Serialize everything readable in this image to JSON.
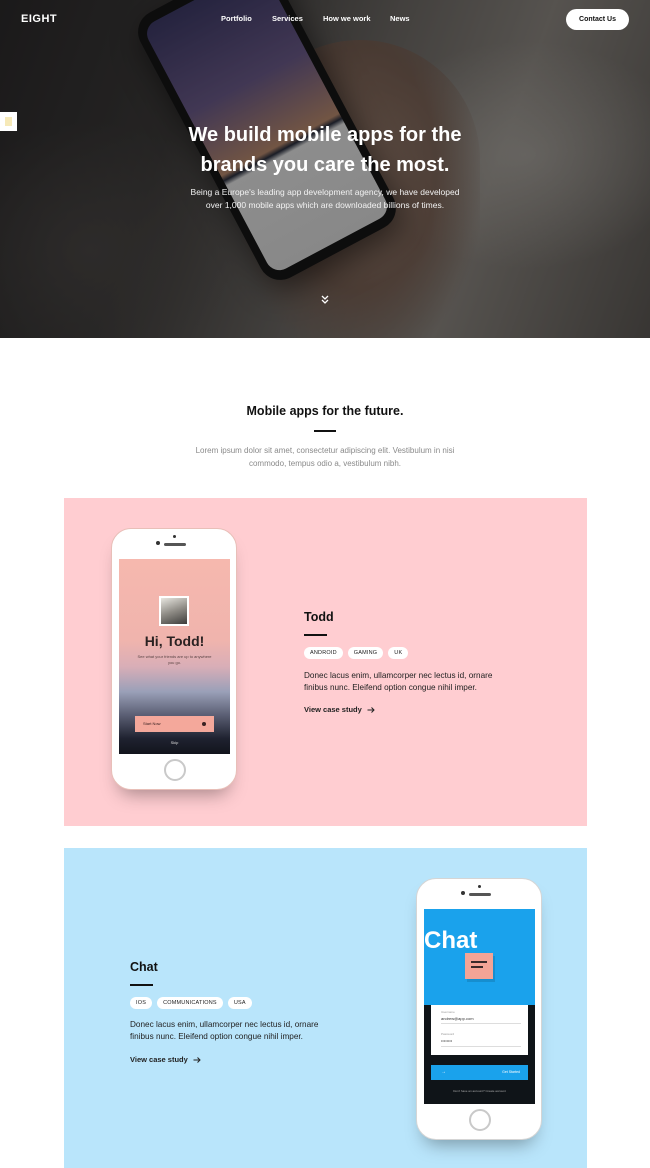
{
  "nav": {
    "logo": "EIGHT",
    "links": [
      "Portfolio",
      "Services",
      "How we work",
      "News"
    ],
    "contact_label": "Contact Us"
  },
  "hero": {
    "title_line1": "We build mobile apps for the",
    "title_line2": "brands you care the most.",
    "subtitle_line1": "Being a Europe's leading app development agency, we have developed",
    "subtitle_line2": "over 1,000 mobile apps which are downloaded billions of times.",
    "scroll_icon": "double-chevron-down-icon"
  },
  "intro": {
    "title": "Mobile apps for the future.",
    "text_line1": "Lorem ipsum dolor sit amet, consectetur adipiscing elit. Vestibulum in nisi",
    "text_line2": "commodo, tempus odio a, vestibulum nibh."
  },
  "cases": [
    {
      "title": "Todd",
      "tags": [
        "ANDROID",
        "GAMING",
        "UK"
      ],
      "desc_line1": "Donec lacus enim, ullamcorper nec lectus id, ornare",
      "desc_line2": "finibus nunc. Eleifend option congue nihil imper.",
      "link": "View case study",
      "phone": {
        "greeting": "Hi, Todd!",
        "blurb": "See what your friends are up to anywhere you go.",
        "button": "Start Now",
        "skip": "Skip"
      },
      "background": "#ffcdd1"
    },
    {
      "title": "Chat",
      "tags": [
        "IOS",
        "COMMUNICATIONS",
        "USA"
      ],
      "desc_line1": "Donec lacus enim, ullamcorper nec lectus id, ornare",
      "desc_line2": "finibus nunc. Eleifend option congue nihil imper.",
      "link": "View case study",
      "phone": {
        "title": "Chat",
        "email_label": "Username",
        "email_value": "andrew@app.com",
        "password_label": "Password",
        "password_value": "••••••••",
        "submit": "Get Started",
        "footer": "Don't have an account? Create account"
      },
      "background": "#b9e5fb"
    }
  ],
  "colors": {
    "accent_pink": "#ffcdd1",
    "accent_blue": "#b9e5fb",
    "text_dark": "#111111",
    "muted": "#8a8a8a"
  }
}
